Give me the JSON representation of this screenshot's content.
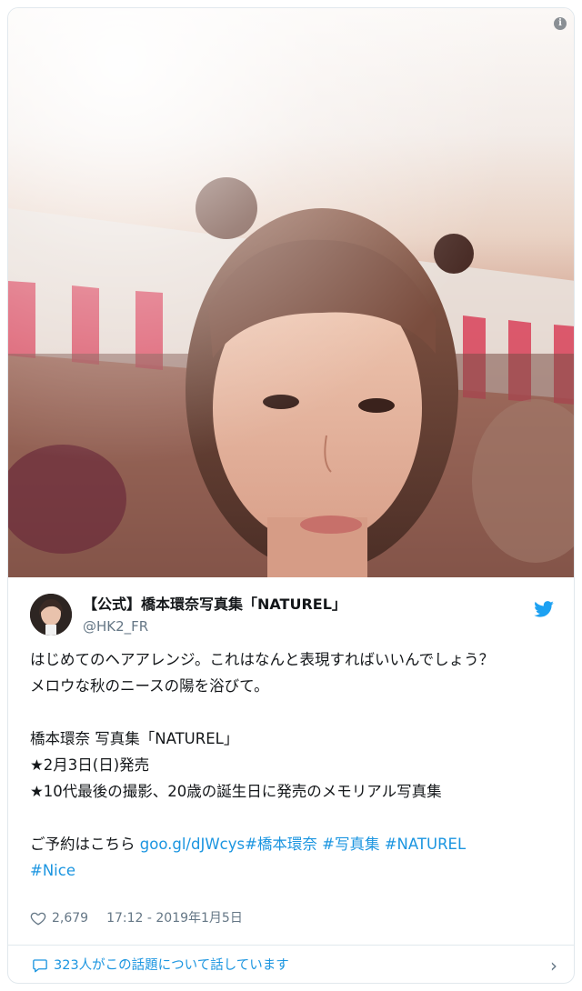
{
  "tweet": {
    "account_name": "【公式】橋本環奈写真集「NATUREL」",
    "handle": "@HK2_FR",
    "body_line1": "はじめてのヘアアレンジ。これはなんと表現すればいいんでしょう？",
    "body_line2": "メロウな秋のニースの陽を浴びて。",
    "body_line3": "橋本環奈 写真集「NATUREL」",
    "body_line4": "★2月3日(日)発売",
    "body_line5": "★10代最後の撮影、20歳の誕生日に発売のメモリアル写真集",
    "body_line6_prefix": "ご予約はこちら ",
    "link_url": "goo.gl/dJWcys",
    "hashtag_1": "#橋本環奈",
    "hashtag_2": "#写真集",
    "hashtag_3": "#NATUREL",
    "hashtag_4": "#Nice",
    "likes": "2,679",
    "timestamp": "17:12 - 2019年1月5日",
    "conversation_text": "323人がこの話題について話しています",
    "chevron": "›",
    "info_glyph": "i"
  },
  "icons": {
    "photo": "portrait-photo",
    "avatar": "avatar",
    "bird": "twitter-bird-icon",
    "heart": "heart-icon",
    "bubble": "speech-bubble-icon",
    "info": "info-icon",
    "chevron": "chevron-right-icon"
  },
  "colors": {
    "link": "#1b95e0",
    "secondary_text": "#657786",
    "border": "#e1e8ed",
    "text": "#14171a"
  }
}
